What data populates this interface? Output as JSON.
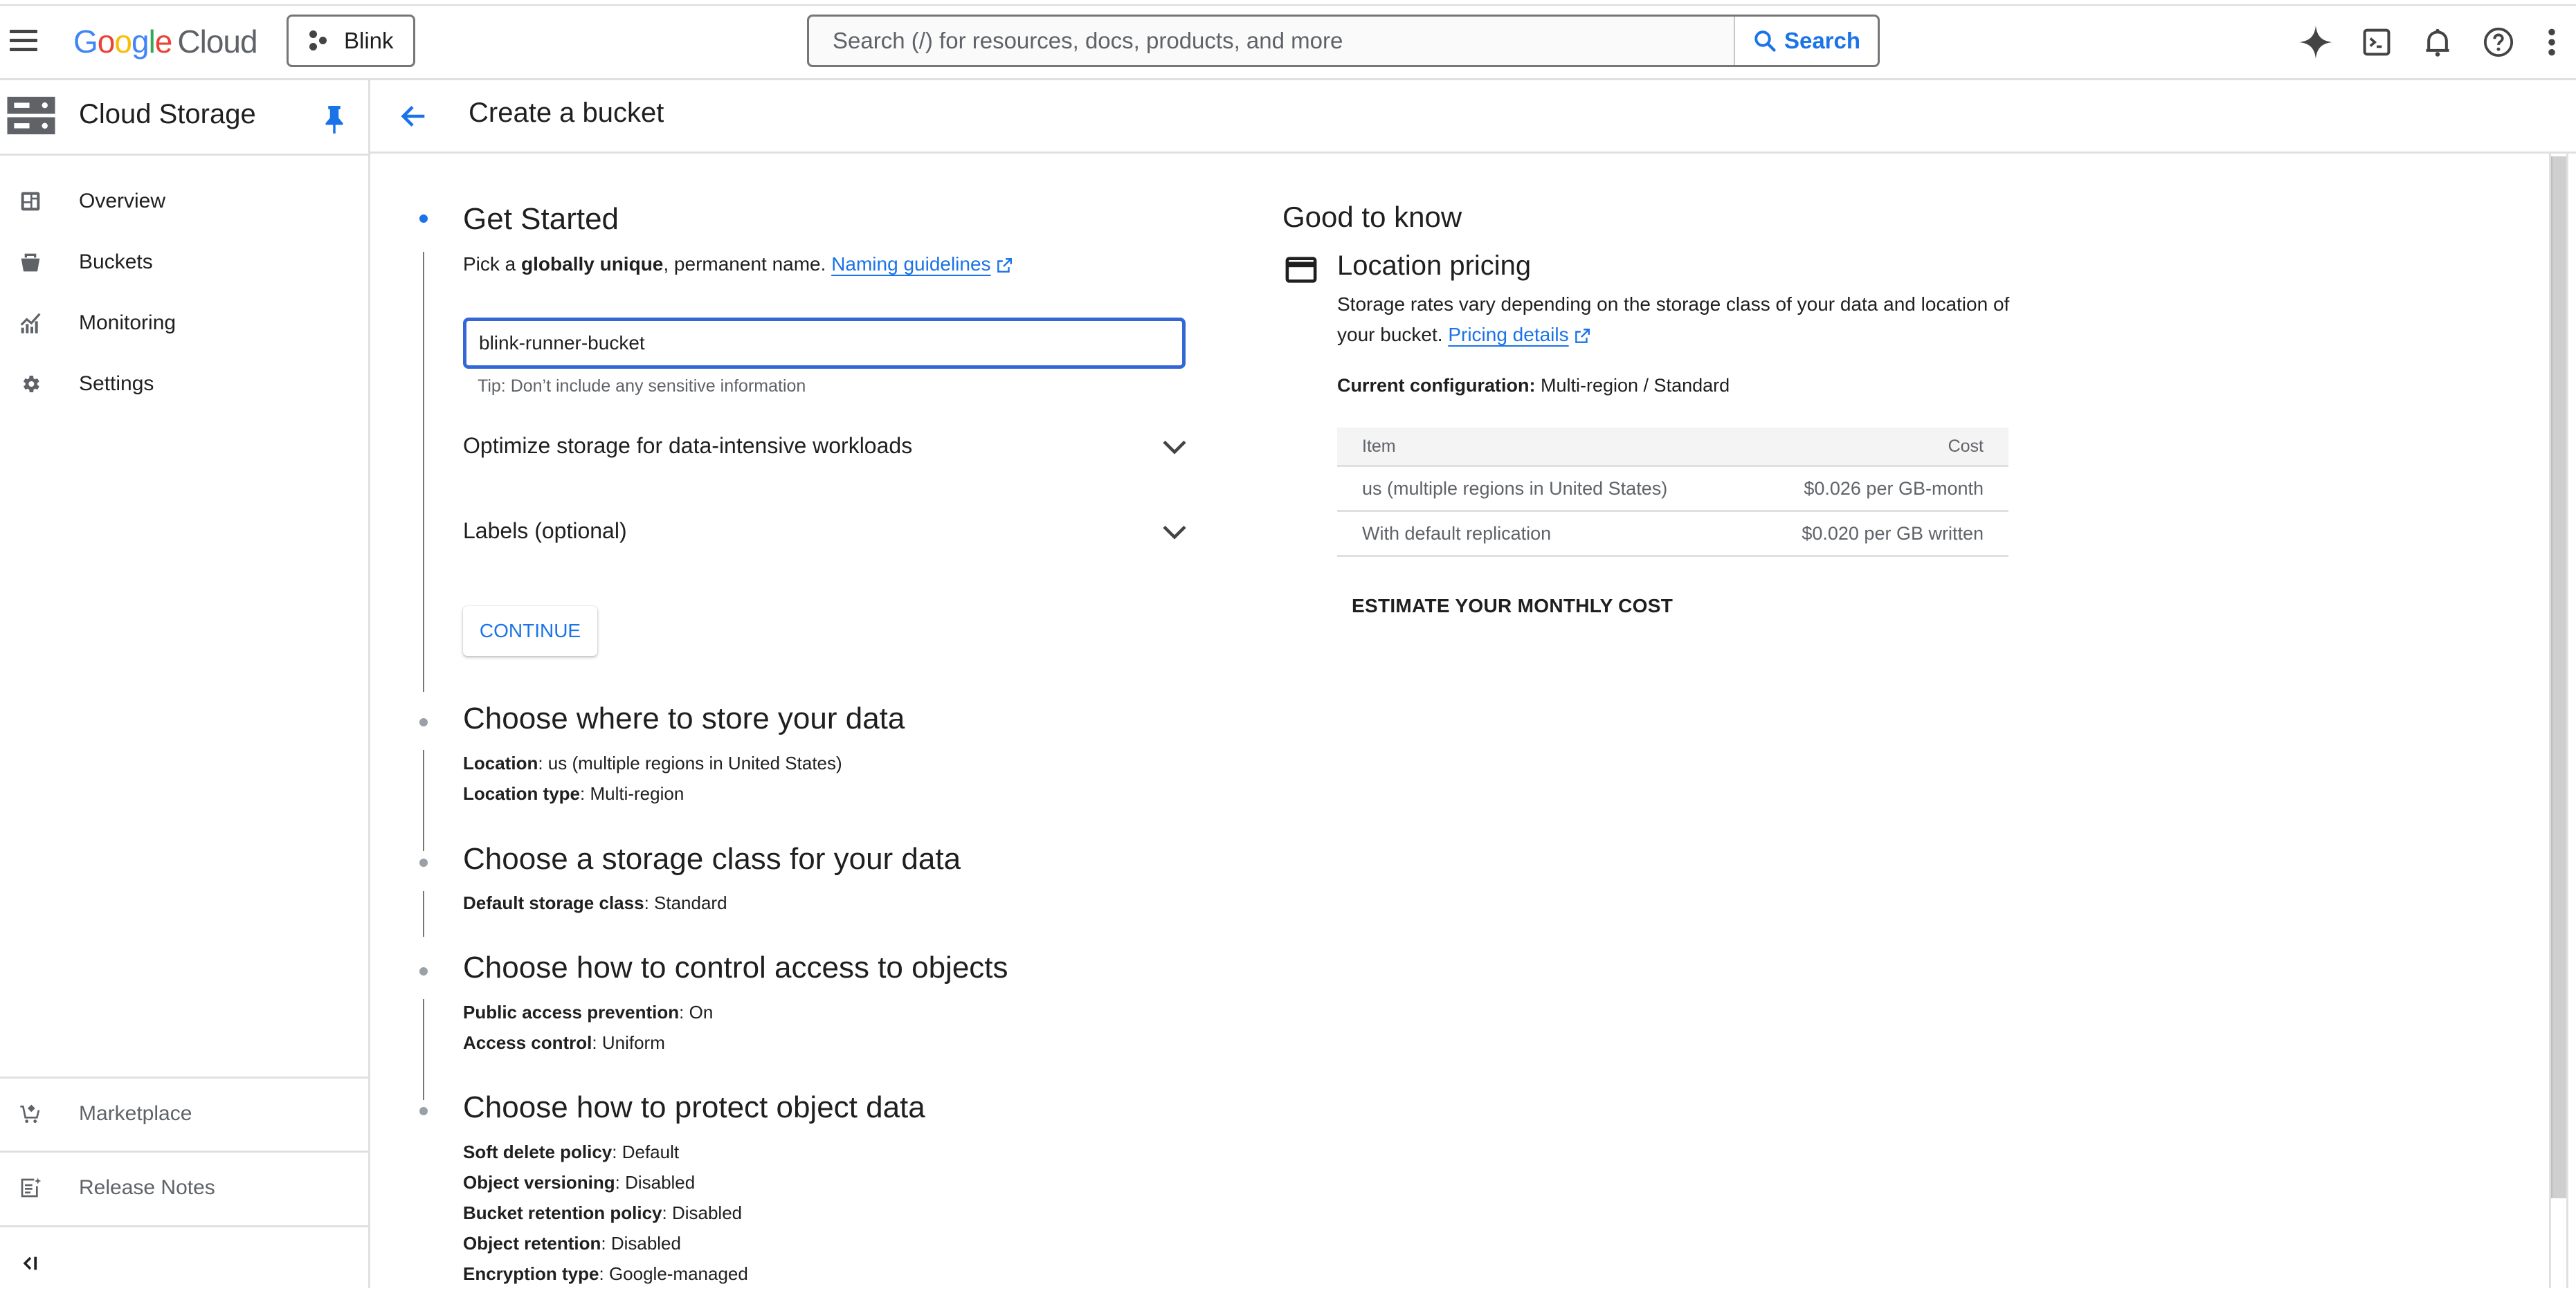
{
  "topbar": {
    "menu_icon": "hamburger-menu-icon",
    "logo": {
      "google": [
        "G",
        "o",
        "o",
        "g",
        "l",
        "e"
      ],
      "cloud": "Cloud"
    },
    "project": {
      "label": "Blink",
      "icon": "project-hexagon-icon"
    },
    "search": {
      "placeholder": "Search (/) for resources, docs, products, and more",
      "value": "",
      "button_label": "Search"
    },
    "right_icons": [
      "gemini-sparkle-icon",
      "cloud-shell-terminal-icon",
      "notifications-bell-icon",
      "help-icon",
      "more-vert-icon"
    ]
  },
  "sidebar": {
    "product_title": "Cloud Storage",
    "product_icon": "storage-server-icon",
    "pin_icon": "pin-icon",
    "items": [
      {
        "label": "Overview",
        "icon": "dashboard-icon"
      },
      {
        "label": "Buckets",
        "icon": "bucket-icon"
      },
      {
        "label": "Monitoring",
        "icon": "monitoring-chart-icon"
      },
      {
        "label": "Settings",
        "icon": "gear-icon"
      }
    ],
    "bottom_items": [
      {
        "label": "Marketplace",
        "icon": "marketplace-cart-icon"
      },
      {
        "label": "Release Notes",
        "icon": "release-notes-icon"
      }
    ],
    "collapse_icon": "collapse-sidebar-icon"
  },
  "page": {
    "title": "Create a bucket",
    "back_icon": "arrow-back-icon"
  },
  "steps": {
    "get_started": {
      "title": "Get Started",
      "desc_prefix": "Pick a ",
      "desc_bold": "globally unique",
      "desc_suffix": ", permanent name. ",
      "link": "Naming guidelines",
      "input_value": "blink-runner-bucket",
      "tip": "Tip: Don’t include any sensitive information",
      "expanders": [
        {
          "label": "Optimize storage for data-intensive workloads"
        },
        {
          "label": "Labels (optional)"
        }
      ],
      "continue_label": "CONTINUE"
    },
    "location": {
      "title": "Choose where to store your data",
      "rows": [
        {
          "key": "Location",
          "value": "us (multiple regions in United States)"
        },
        {
          "key": "Location type",
          "value": "Multi-region"
        }
      ]
    },
    "storage_class": {
      "title": "Choose a storage class for your data",
      "rows": [
        {
          "key": "Default storage class",
          "value": "Standard"
        }
      ]
    },
    "access": {
      "title": "Choose how to control access to objects",
      "rows": [
        {
          "key": "Public access prevention",
          "value": "On"
        },
        {
          "key": "Access control",
          "value": "Uniform"
        }
      ]
    },
    "protection": {
      "title": "Choose how to protect object data",
      "rows": [
        {
          "key": "Soft delete policy",
          "value": "Default"
        },
        {
          "key": "Object versioning",
          "value": "Disabled"
        },
        {
          "key": "Bucket retention policy",
          "value": "Disabled"
        },
        {
          "key": "Object retention",
          "value": "Disabled"
        },
        {
          "key": "Encryption type",
          "value": "Google-managed"
        }
      ]
    }
  },
  "good_to_know": {
    "heading": "Good to know",
    "section_title": "Location pricing",
    "section_icon": "credit-card-icon",
    "paragraph": "Storage rates vary depending on the storage class of your data and location of your bucket. ",
    "link": "Pricing details",
    "config_label": "Current configuration:",
    "config_value": "Multi-region / Standard",
    "table": {
      "headers": [
        "Item",
        "Cost"
      ],
      "rows": [
        [
          "us (multiple regions in United States)",
          "$0.026 per GB-month"
        ],
        [
          "With default replication",
          "$0.020 per GB written"
        ]
      ]
    },
    "estimate_label": "ESTIMATE YOUR MONTHLY COST"
  },
  "colors": {
    "accent": "#1a73e8",
    "input_focus": "#3367d6",
    "step_inactive": "#9aa0a6",
    "text": "#1f1f1f",
    "muted": "#5f6368"
  }
}
